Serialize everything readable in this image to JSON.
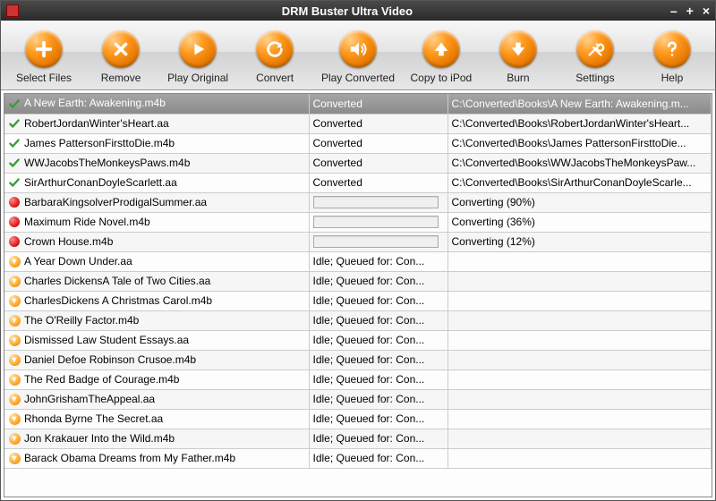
{
  "window": {
    "title": "DRM Buster Ultra Video"
  },
  "toolbar": {
    "select_files": "Select Files",
    "remove": "Remove",
    "play_original": "Play Original",
    "convert": "Convert",
    "play_converted": "Play Converted",
    "copy_to_ipod": "Copy to iPod",
    "burn": "Burn",
    "settings": "Settings",
    "help": "Help"
  },
  "rows": [
    {
      "name": "A New Earth: Awakening.m4b",
      "status_text": "Converted",
      "path": "C:\\Converted\\Books\\A New Earth: Awakening.m...",
      "state": "done",
      "selected": true
    },
    {
      "name": "RobertJordanWinter'sHeart.aa",
      "status_text": "Converted",
      "path": "C:\\Converted\\Books\\RobertJordanWinter'sHeart...",
      "state": "done"
    },
    {
      "name": "James PattersonFirsttoDie.m4b",
      "status_text": "Converted",
      "path": "C:\\Converted\\Books\\James PattersonFirsttoDie...",
      "state": "done"
    },
    {
      "name": "WWJacobsTheMonkeysPaws.m4b",
      "status_text": "Converted",
      "path": "C:\\Converted\\Books\\WWJacobsTheMonkeysPaw...",
      "state": "done"
    },
    {
      "name": "SirArthurConanDoyleScarlett.aa",
      "status_text": "Converted",
      "path": "C:\\Converted\\Books\\SirArthurConanDoyleScarle...",
      "state": "done"
    },
    {
      "name": "BarbaraKingsolverProdigalSummer.aa",
      "progress": 90,
      "path": "Converting (90%)",
      "state": "converting"
    },
    {
      "name": "Maximum Ride Novel.m4b",
      "progress": 36,
      "path": "Converting (36%)",
      "state": "converting"
    },
    {
      "name": "Crown House.m4b",
      "progress": 12,
      "path": "Converting (12%)",
      "state": "converting"
    },
    {
      "name": "A Year Down Under.aa",
      "status_text": "Idle; Queued for: Con...",
      "path": "",
      "state": "queued"
    },
    {
      "name": "Charles DickensA Tale of Two Cities.aa",
      "status_text": "Idle; Queued for: Con...",
      "path": "",
      "state": "queued"
    },
    {
      "name": "CharlesDickens A Christmas Carol.m4b",
      "status_text": "Idle; Queued for: Con...",
      "path": "",
      "state": "queued"
    },
    {
      "name": "The O'Reilly Factor.m4b",
      "status_text": "Idle; Queued for: Con...",
      "path": "",
      "state": "queued"
    },
    {
      "name": "Dismissed Law Student Essays.aa",
      "status_text": "Idle; Queued for: Con...",
      "path": "",
      "state": "queued"
    },
    {
      "name": "Daniel Defoe Robinson Crusoe.m4b",
      "status_text": "Idle; Queued for: Con...",
      "path": "",
      "state": "queued"
    },
    {
      "name": "The Red Badge of Courage.m4b",
      "status_text": "Idle; Queued for: Con...",
      "path": "",
      "state": "queued"
    },
    {
      "name": "JohnGrishamTheAppeal.aa",
      "status_text": "Idle; Queued for: Con...",
      "path": "",
      "state": "queued"
    },
    {
      "name": "Rhonda Byrne The Secret.aa",
      "status_text": "Idle; Queued for: Con...",
      "path": "",
      "state": "queued"
    },
    {
      "name": "Jon Krakauer Into the Wild.m4b",
      "status_text": "Idle; Queued for: Con...",
      "path": "",
      "state": "queued"
    },
    {
      "name": "Barack Obama Dreams from My Father.m4b",
      "status_text": "Idle; Queued for: Con...",
      "path": "",
      "state": "queued"
    }
  ]
}
